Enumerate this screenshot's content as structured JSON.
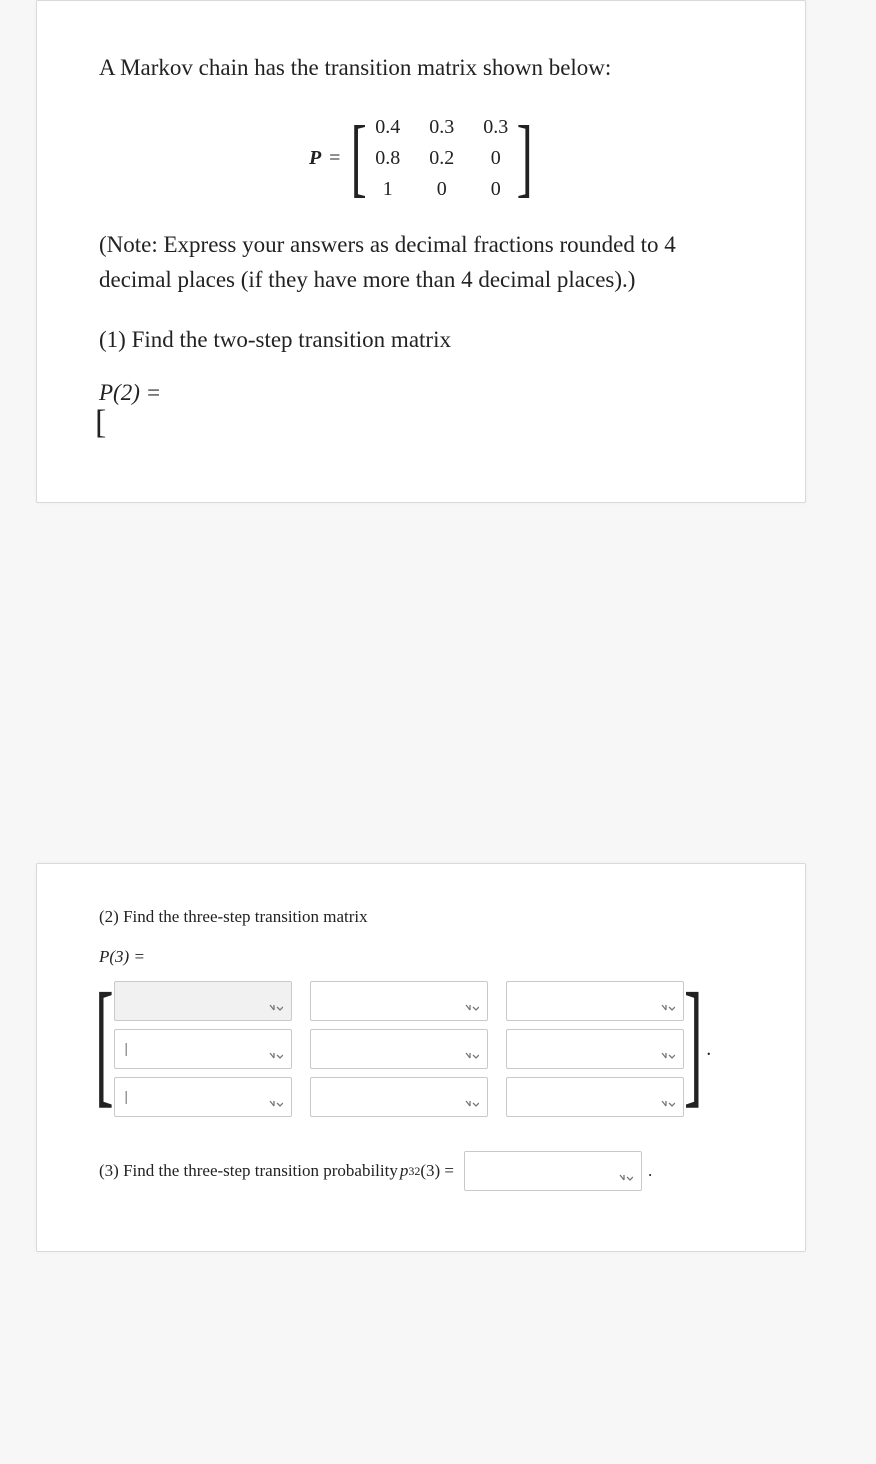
{
  "top": {
    "intro": "A Markov chain has the transition matrix shown below:",
    "matrix_label": "P",
    "equals": "=",
    "matrix": {
      "r1c1": "0.4",
      "r1c2": "0.3",
      "r1c3": "0.3",
      "r2c1": "0.8",
      "r2c2": "0.2",
      "r2c3": "0",
      "r3c1": "1",
      "r3c2": "0",
      "r3c3": "0"
    },
    "note": "(Note: Express your answers as decimal fractions rounded to 4 decimal places (if they have more than 4 decimal places).)",
    "q1": "(1) Find the two-step transition matrix",
    "p2label": "P(2) =",
    "open_bracket": "["
  },
  "bottom": {
    "q2": "(2) Find the three-step transition matrix",
    "p3label": "P(3) =",
    "cells": {
      "r1c1": "",
      "r1c2": "",
      "r1c3": "",
      "r2c1": "|",
      "r2c2": "",
      "r2c3": "",
      "r3c1": "|",
      "r3c2": "",
      "r3c3": ""
    },
    "period": ".",
    "q3_prefix": "(3) Find the three-step transition probability ",
    "q3_symbol": "p",
    "q3_sub": "32",
    "q3_arg": "(3) =",
    "q3_value": "",
    "q3_dot": "."
  }
}
